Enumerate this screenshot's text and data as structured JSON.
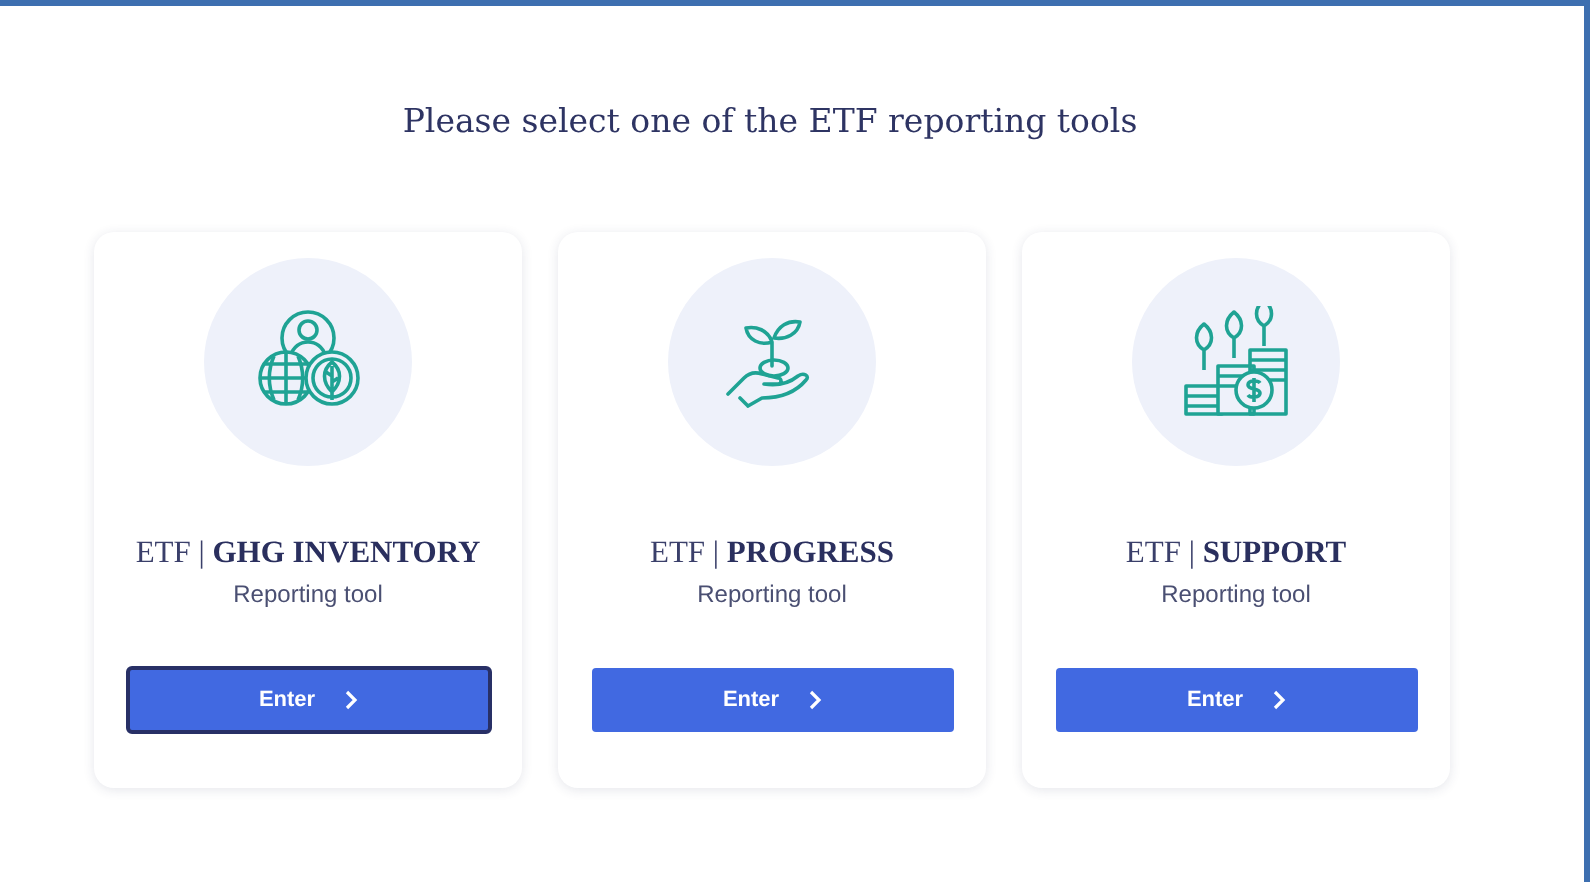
{
  "heading": "Please select one of the ETF reporting tools",
  "tools": [
    {
      "kind": "inventory",
      "title": "ETF | **GHG INVENTORY**",
      "subtitle": "Reporting tool",
      "button": "Enter",
      "focused": true
    },
    {
      "kind": "progress",
      "title": "ETF | **PROGRESS**",
      "subtitle": "Reporting tool",
      "button": "Enter",
      "focused": false
    },
    {
      "kind": "support",
      "title": "ETF | **SUPPORT**",
      "subtitle": "Reporting tool",
      "button": "Enter",
      "focused": false
    }
  ]
}
